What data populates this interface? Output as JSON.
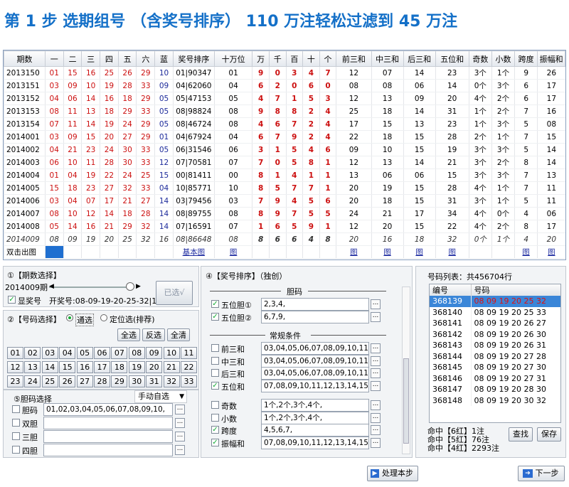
{
  "title": "第 1 步  选期组号  （含奖号排序） 110 万注轻松过滤到 45 万注",
  "grid": {
    "headers": [
      "期数",
      "一",
      "二",
      "三",
      "四",
      "五",
      "六",
      "蓝",
      "奖号排序",
      "十万位",
      "万",
      "千",
      "百",
      "十",
      "个",
      "前三和",
      "中三和",
      "后三和",
      "五位和",
      "奇数",
      "小数",
      "跨度",
      "振幅和"
    ],
    "rows": [
      [
        "2013150",
        "01",
        "15",
        "16",
        "25",
        "26",
        "29",
        "10",
        "01|90347",
        "01",
        "9",
        "0",
        "3",
        "4",
        "7",
        "12",
        "07",
        "14",
        "23",
        "3个",
        "1个",
        "9",
        "26"
      ],
      [
        "2013151",
        "03",
        "09",
        "10",
        "19",
        "28",
        "33",
        "09",
        "04|62060",
        "04",
        "6",
        "2",
        "0",
        "6",
        "0",
        "08",
        "08",
        "06",
        "14",
        "0个",
        "3个",
        "6",
        "17"
      ],
      [
        "2013152",
        "04",
        "06",
        "14",
        "16",
        "18",
        "29",
        "05",
        "05|47153",
        "05",
        "4",
        "7",
        "1",
        "5",
        "3",
        "12",
        "13",
        "09",
        "20",
        "4个",
        "2个",
        "6",
        "17"
      ],
      [
        "2013153",
        "08",
        "11",
        "13",
        "18",
        "29",
        "33",
        "05",
        "08|98824",
        "08",
        "9",
        "8",
        "8",
        "2",
        "4",
        "25",
        "18",
        "14",
        "31",
        "1个",
        "2个",
        "7",
        "16"
      ],
      [
        "2013154",
        "07",
        "11",
        "14",
        "19",
        "24",
        "29",
        "05",
        "08|46724",
        "08",
        "4",
        "6",
        "7",
        "2",
        "4",
        "17",
        "15",
        "13",
        "23",
        "1个",
        "3个",
        "5",
        "08"
      ],
      [
        "2014001",
        "03",
        "09",
        "15",
        "20",
        "27",
        "29",
        "01",
        "04|67924",
        "04",
        "6",
        "7",
        "9",
        "2",
        "4",
        "22",
        "18",
        "15",
        "28",
        "2个",
        "1个",
        "7",
        "15"
      ],
      [
        "2014002",
        "04",
        "21",
        "23",
        "24",
        "30",
        "33",
        "05",
        "06|31546",
        "06",
        "3",
        "1",
        "5",
        "4",
        "6",
        "09",
        "10",
        "15",
        "19",
        "3个",
        "3个",
        "5",
        "14"
      ],
      [
        "2014003",
        "06",
        "10",
        "11",
        "28",
        "30",
        "33",
        "12",
        "07|70581",
        "07",
        "7",
        "0",
        "5",
        "8",
        "1",
        "12",
        "13",
        "14",
        "21",
        "3个",
        "2个",
        "8",
        "14"
      ],
      [
        "2014004",
        "01",
        "04",
        "19",
        "22",
        "24",
        "25",
        "15",
        "00|81411",
        "00",
        "8",
        "1",
        "4",
        "1",
        "1",
        "13",
        "06",
        "06",
        "15",
        "3个",
        "3个",
        "7",
        "13"
      ],
      [
        "2014005",
        "15",
        "18",
        "23",
        "27",
        "32",
        "33",
        "04",
        "10|85771",
        "10",
        "8",
        "5",
        "7",
        "7",
        "1",
        "20",
        "19",
        "15",
        "28",
        "4个",
        "1个",
        "7",
        "11"
      ],
      [
        "2014006",
        "03",
        "04",
        "07",
        "17",
        "21",
        "27",
        "14",
        "03|79456",
        "03",
        "7",
        "9",
        "4",
        "5",
        "6",
        "20",
        "18",
        "15",
        "31",
        "3个",
        "1个",
        "5",
        "11"
      ],
      [
        "2014007",
        "08",
        "10",
        "12",
        "14",
        "18",
        "28",
        "14",
        "08|89755",
        "08",
        "8",
        "9",
        "7",
        "5",
        "5",
        "24",
        "21",
        "17",
        "34",
        "4个",
        "0个",
        "4",
        "06"
      ],
      [
        "2014008",
        "05",
        "14",
        "16",
        "21",
        "29",
        "32",
        "14",
        "07|16591",
        "07",
        "1",
        "6",
        "5",
        "9",
        "1",
        "12",
        "20",
        "15",
        "22",
        "4个",
        "2个",
        "8",
        "17"
      ],
      [
        "2014009",
        "08",
        "09",
        "19",
        "20",
        "25",
        "32",
        "16",
        "08|86648",
        "08",
        "8",
        "6",
        "6",
        "4",
        "8",
        "20",
        "16",
        "18",
        "32",
        "0个",
        "1个",
        "4",
        "20"
      ]
    ],
    "footer": {
      "double_click": "双击出图",
      "basic": "基本图",
      "chart": "图"
    }
  },
  "period": {
    "title": "①【期数选择】",
    "value": "2014009期",
    "show_label": "显奖号",
    "winning": "开奖号:08-09-19-20-25-32|16",
    "selected_btn": "已选√"
  },
  "numsel": {
    "title": "②【号码选择】",
    "opt1": "通选",
    "opt2": "定位选(排荐)",
    "all": "全选",
    "invert": "反选",
    "clear": "全清",
    "nums": [
      "01",
      "02",
      "03",
      "04",
      "05",
      "06",
      "07",
      "08",
      "09",
      "10",
      "11",
      "12",
      "13",
      "14",
      "15",
      "16",
      "17",
      "18",
      "19",
      "20",
      "21",
      "22",
      "23",
      "24",
      "25",
      "26",
      "27",
      "28",
      "29",
      "30",
      "31",
      "32",
      "33"
    ]
  },
  "dan": {
    "title": "⑤胆码选择",
    "mode": "手动自选",
    "rows": [
      {
        "label": "胆码",
        "value": "01,02,03,04,05,06,07,08,09,10,"
      },
      {
        "label": "双胆",
        "value": ""
      },
      {
        "label": "三胆",
        "value": ""
      },
      {
        "label": "四胆",
        "value": ""
      }
    ]
  },
  "sort": {
    "title": "④【奖号排序】（独创）",
    "dan_header": "胆码",
    "dan_rows": [
      {
        "label": "五位胆①",
        "value": "2,3,4,",
        "checked": true
      },
      {
        "label": "五位胆②",
        "value": "6,7,9,",
        "checked": true
      }
    ],
    "cond_header": "常规条件",
    "cond_rows": [
      {
        "label": "前三和",
        "value": "03,04,05,06,07,08,09,10,11,12,",
        "checked": false
      },
      {
        "label": "中三和",
        "value": "03,04,05,06,07,08,09,10,11,12,",
        "checked": false
      },
      {
        "label": "后三和",
        "value": "03,04,05,06,07,08,09,10,11,12,",
        "checked": false
      },
      {
        "label": "五位和",
        "value": "07,08,09,10,11,12,13,14,15,16,",
        "checked": true
      }
    ],
    "extra_rows": [
      {
        "label": "奇数",
        "value": "1个,2个,3个,4个,",
        "checked": false
      },
      {
        "label": "小数",
        "value": "1个,2个,3个,4个,",
        "checked": false
      },
      {
        "label": "跨度",
        "value": "4,5,6,7,",
        "checked": true
      },
      {
        "label": "振幅和",
        "value": "07,08,09,10,11,12,13,14,15,16,",
        "checked": true
      }
    ],
    "process_btn": "处理本步"
  },
  "list": {
    "title": "号码列表：共456704行",
    "col1": "编号",
    "col2": "号码",
    "rows": [
      [
        "368139",
        "08 09 19 20 25 32"
      ],
      [
        "368140",
        "08 09 19 20 25 33"
      ],
      [
        "368141",
        "08 09 19 20 26 27"
      ],
      [
        "368142",
        "08 09 19 20 26 30"
      ],
      [
        "368143",
        "08 09 19 20 26 31"
      ],
      [
        "368144",
        "08 09 19 20 27 28"
      ],
      [
        "368145",
        "08 09 19 20 27 30"
      ],
      [
        "368146",
        "08 09 19 20 27 31"
      ],
      [
        "368147",
        "08 09 19 20 28 30"
      ],
      [
        "368148",
        "08 09 19 20 30 32"
      ]
    ],
    "hits": [
      "命中【6红】1注",
      "命中【5红】76注",
      "命中【4红】2293注"
    ],
    "find_btn": "查找",
    "save_btn": "保存",
    "next_btn": "下一步"
  }
}
